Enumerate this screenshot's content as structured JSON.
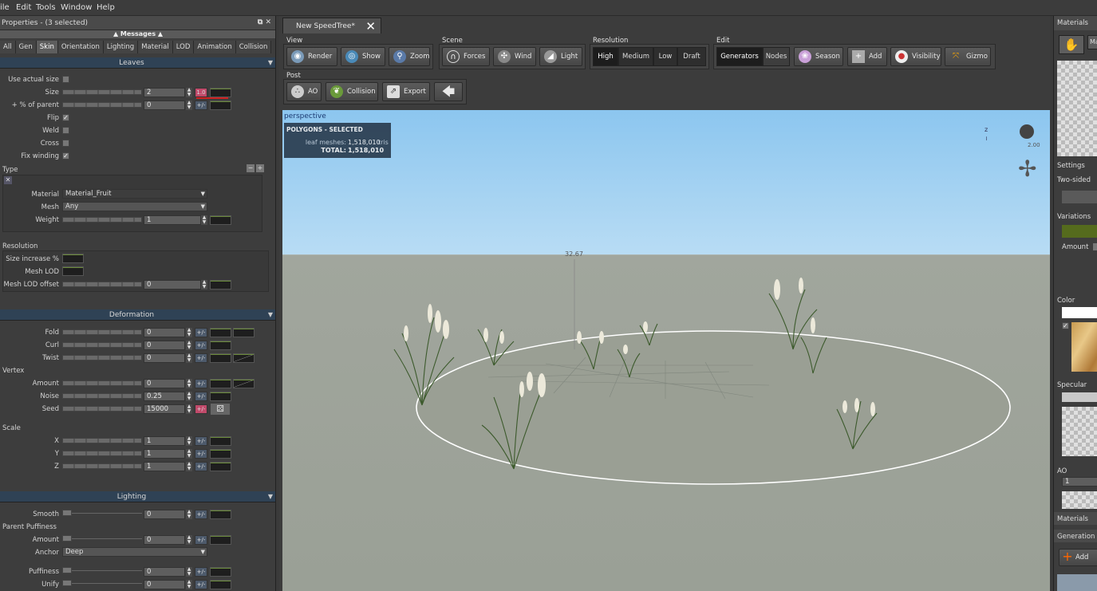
{
  "menu": [
    "ile",
    "Edit",
    "Tools",
    "Window",
    "Help"
  ],
  "properties": {
    "title": "Properties - (3 selected)",
    "messages": "▲ Messages ▲",
    "tabs": [
      "All",
      "Gen",
      "Skin",
      "Orientation",
      "Lighting",
      "Material",
      "LOD",
      "Animation",
      "Collision"
    ],
    "selected_tab": "Skin",
    "leaves_header": "Leaves",
    "use_actual_size": "Use actual size",
    "size": {
      "label": "Size",
      "value": "2",
      "red": "1.0"
    },
    "pct_parent": {
      "label": "+ % of parent",
      "value": "0",
      "pm": "+/-"
    },
    "flip": "Flip",
    "weld": "Weld",
    "cross": "Cross",
    "fix_winding": "Fix winding",
    "type_label": "Type",
    "material": {
      "label": "Material",
      "value": "Material_Fruit"
    },
    "mesh": {
      "label": "Mesh",
      "value": "Any"
    },
    "weight": {
      "label": "Weight",
      "value": "1"
    },
    "resolution_label": "Resolution",
    "size_increase": "Size increase %",
    "mesh_lod": "Mesh LOD",
    "mesh_lod_offset": {
      "label": "Mesh LOD offset",
      "value": "0"
    },
    "deformation_header": "Deformation",
    "fold": {
      "label": "Fold",
      "value": "0"
    },
    "curl": {
      "label": "Curl",
      "value": "0"
    },
    "twist": {
      "label": "Twist",
      "value": "0"
    },
    "vertex_label": "Vertex",
    "amount": {
      "label": "Amount",
      "value": "0"
    },
    "noise": {
      "label": "Noise",
      "value": "0.25"
    },
    "seed": {
      "label": "Seed",
      "value": "15000"
    },
    "scale_label": "Scale",
    "x": {
      "label": "X",
      "value": "1"
    },
    "y": {
      "label": "Y",
      "value": "1"
    },
    "z": {
      "label": "Z",
      "value": "1"
    },
    "lighting_header": "Lighting",
    "smooth": {
      "label": "Smooth",
      "value": "0"
    },
    "parent_puffiness": "Parent Puffiness",
    "pp_amount": {
      "label": "Amount",
      "value": "0"
    },
    "anchor": {
      "label": "Anchor",
      "value": "Deep"
    },
    "puffiness": {
      "label": "Puffiness",
      "value": "0"
    },
    "unify": {
      "label": "Unify",
      "value": "0"
    },
    "pm": "+/-"
  },
  "doc_tab": "New SpeedTree*",
  "toolbar": {
    "view": {
      "label": "View",
      "render": "Render",
      "show": "Show",
      "zoom": "Zoom"
    },
    "scene": {
      "label": "Scene",
      "forces": "Forces",
      "wind": "Wind",
      "light": "Light"
    },
    "resolution": {
      "label": "Resolution",
      "high": "High",
      "medium": "Medium",
      "low": "Low",
      "draft": "Draft"
    },
    "edit": {
      "label": "Edit",
      "generators": "Generators",
      "nodes": "Nodes",
      "season": "Season",
      "add": "Add",
      "visibility": "Visibility",
      "gizmo": "Gizmo"
    },
    "post": {
      "label": "Post",
      "ao": "AO",
      "collision": "Collision",
      "export": "Export"
    }
  },
  "viewport": {
    "name": "perspective",
    "stats_title": "POLYGONS - SELECTED",
    "leaf_meshes_label": "leaf meshes:",
    "leaf_meshes": "1,518,010",
    "tris": "tris",
    "total_label": "TOTAL:",
    "total": "1,518,010",
    "height": "32.67",
    "light_value": "2.00"
  },
  "right": {
    "materials": "Materials",
    "ma": "Ma",
    "settings": "Settings",
    "two_sided": "Two-sided",
    "variations": "Variations",
    "amount": "Amount",
    "color": "Color",
    "specular": "Specular",
    "ao": "AO",
    "ao_value": "1",
    "materials2": "Materials",
    "generation": "Generation",
    "add": "Add"
  },
  "colors": {
    "accent": "#2f4255",
    "sky": "#9fd0f2",
    "ground": "#9ca195"
  }
}
